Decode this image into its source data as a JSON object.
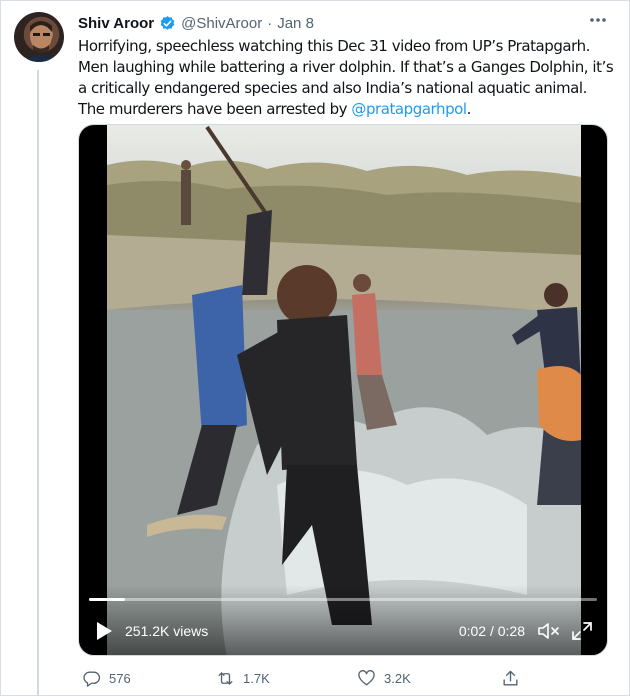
{
  "tweet": {
    "author_name": "Shiv Aroor",
    "handle": "@ShivAroor",
    "separator": "·",
    "date": "Jan 8",
    "more_icon": "more-horizontal-icon",
    "text_before_mention": "Horrifying, speechless watching this Dec 31 video from UP’s Pratapgarh. Men laughing while battering a river dolphin. If that’s a Ganges Dolphin, it’s a critically endangered species and also India’s national aquatic animal. The murderers have been arrested by ",
    "mention": "@pratapgarhpol",
    "text_after_mention": "."
  },
  "video": {
    "views": "251.2K views",
    "time": "0:02 / 0:28",
    "progress_fraction": 0.071
  },
  "actions": {
    "reply_count": "576",
    "retweet_count": "1.7K",
    "like_count": "3.2K"
  },
  "colors": {
    "link": "#1d9bf0",
    "verified": "#1d9bf0",
    "secondary_text": "#536471"
  }
}
